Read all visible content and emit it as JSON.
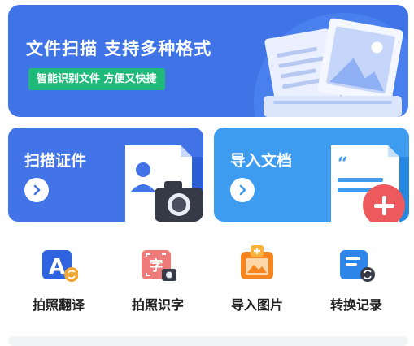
{
  "banner": {
    "title": "文件扫描  支持多种格式",
    "badge": "智能识别文件 方便又快捷"
  },
  "cards": [
    {
      "title": "扫描证件",
      "icon": "id-card-camera-icon"
    },
    {
      "title": "导入文档",
      "icon": "document-add-icon"
    }
  ],
  "tools": [
    {
      "label": "拍照翻译",
      "icon": "photo-translate-icon"
    },
    {
      "label": "拍照识字",
      "icon": "photo-ocr-icon"
    },
    {
      "label": "导入图片",
      "icon": "import-image-icon"
    },
    {
      "label": "转换记录",
      "icon": "conversion-history-icon"
    }
  ],
  "colors": {
    "banner": "#3f73e6",
    "badge": "#1fba7a",
    "card_left": "#4274e8",
    "card_right": "#3d9cf0"
  }
}
